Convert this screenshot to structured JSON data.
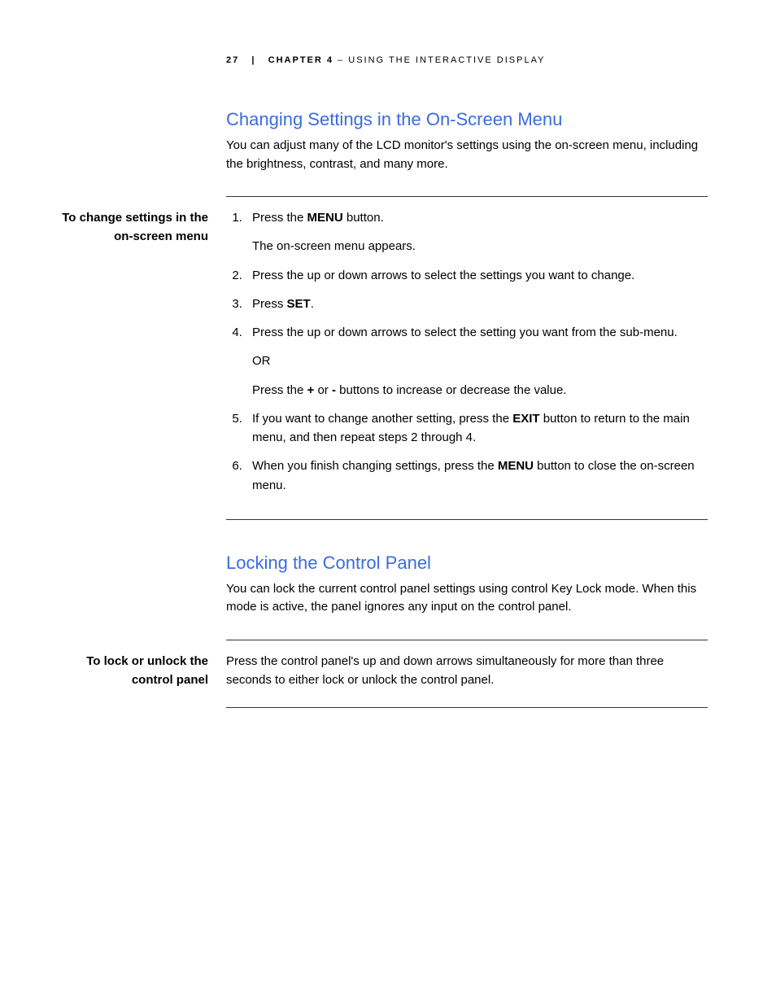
{
  "header": {
    "page_number": "27",
    "separator": "|",
    "chapter_label": "CHAPTER 4",
    "chapter_tail": " – USING THE INTERACTIVE DISPLAY"
  },
  "section1": {
    "title": "Changing Settings in the On-Screen Menu",
    "intro": "You can adjust many of the LCD monitor's settings using the on-screen menu, including the brightness, contrast, and many more.",
    "sidenote": "To change settings in the on-screen menu",
    "steps": {
      "s1_a": "Press the ",
      "s1_bold": "MENU",
      "s1_b": " button.",
      "s1_sub": "The on-screen menu appears.",
      "s2": "Press the up or down arrows to select the settings you want to change.",
      "s3_a": "Press ",
      "s3_bold": "SET",
      "s3_b": ".",
      "s4_a": "Press the up or down arrows to select the setting you want from the sub-menu.",
      "s4_or": "OR",
      "s4_b1": "Press the ",
      "s4_b_bold1": "+",
      "s4_b2": " or ",
      "s4_b_bold2": "-",
      "s4_b3": " buttons to increase or decrease the value.",
      "s5_a": "If you want to change another setting, press the ",
      "s5_bold": "EXIT",
      "s5_b": " button to return to the main menu, and then repeat steps 2 through 4.",
      "s6_a": "When you finish changing settings, press the ",
      "s6_bold": "MENU",
      "s6_b": " button to close the on-screen menu."
    }
  },
  "section2": {
    "title": "Locking the Control Panel",
    "intro": "You can lock the current control panel settings using control Key Lock mode. When this mode is active, the panel ignores any input on the control panel.",
    "sidenote": "To lock or unlock the control panel",
    "body": "Press the control panel's up and down arrows simultaneously for more than three seconds to either lock or unlock the control panel."
  }
}
